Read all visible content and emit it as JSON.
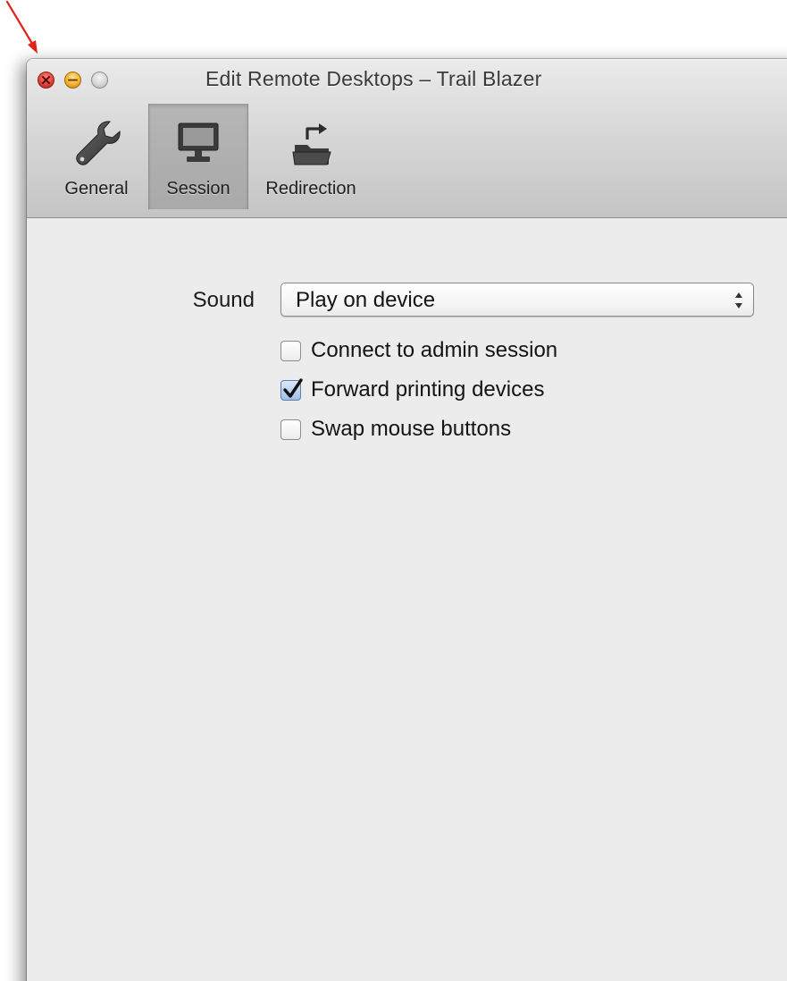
{
  "window": {
    "title": "Edit Remote Desktops – Trail Blazer"
  },
  "toolbar": {
    "items": [
      {
        "label": "General",
        "icon": "wrench-icon",
        "selected": false
      },
      {
        "label": "Session",
        "icon": "monitor-icon",
        "selected": true
      },
      {
        "label": "Redirection",
        "icon": "folder-redirect-icon",
        "selected": false
      }
    ]
  },
  "session": {
    "sound_label": "Sound",
    "sound_value": "Play on device",
    "options": [
      {
        "label": "Connect to admin session",
        "checked": false
      },
      {
        "label": "Forward printing devices",
        "checked": true
      },
      {
        "label": "Swap mouse buttons",
        "checked": false
      }
    ]
  },
  "colors": {
    "window_bg": "#ececec",
    "annotation_arrow": "#e0241b",
    "close": "#e0443a",
    "minimize": "#f6b12d"
  }
}
